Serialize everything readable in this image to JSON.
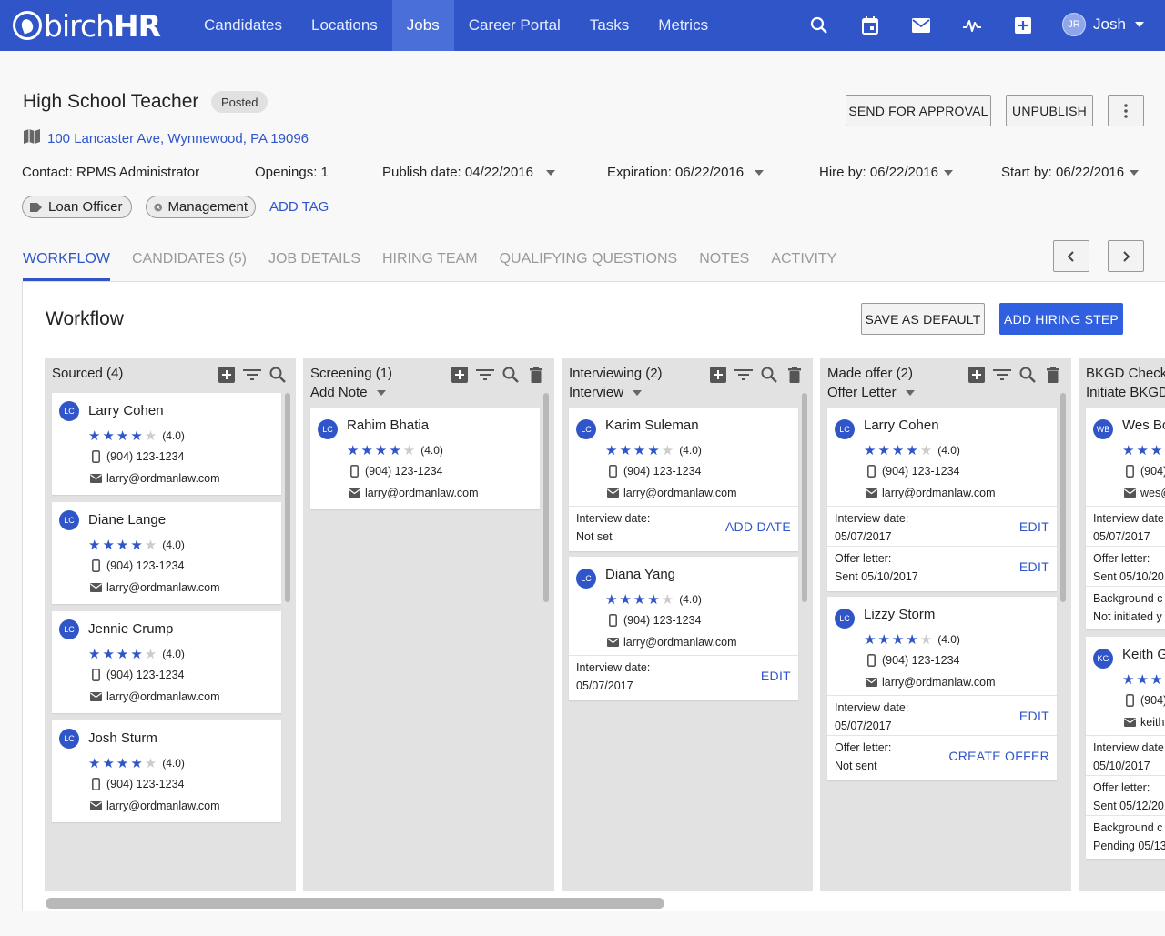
{
  "app": {
    "logo": "birchHR",
    "logo_regular": "birch",
    "logo_bold": "HR"
  },
  "nav": {
    "items": [
      "Candidates",
      "Locations",
      "Jobs",
      "Career Portal",
      "Tasks",
      "Metrics"
    ],
    "active": "Jobs"
  },
  "top_icons": [
    "search-icon",
    "calendar-icon",
    "mail-icon",
    "activity-icon",
    "add-icon"
  ],
  "user": {
    "initials": "JR",
    "name": "Josh"
  },
  "job": {
    "title": "High School Teacher",
    "status": "Posted",
    "address": "100 Lancaster Ave, Wynnewood, PA 19096",
    "contact": "Contact: RPMS Administrator",
    "openings": "Openings: 1",
    "publish": "Publish date: 04/22/2016",
    "expiration": "Expiration: 06/22/2016",
    "hire_by": "Hire by: 06/22/2016",
    "start_by": "Start by: 06/22/2016",
    "tags": [
      "Loan Officer",
      "Management"
    ],
    "add_tag": "ADD TAG"
  },
  "actions": {
    "send_for_approval": "SEND FOR APPROVAL",
    "unpublish": "UNPUBLISH"
  },
  "tabs": [
    "WORKFLOW",
    "CANDIDATES (5)",
    "JOB DETAILS",
    "HIRING TEAM",
    "QUALIFYING QUESTIONS",
    "NOTES",
    "ACTIVITY"
  ],
  "active_tab": "WORKFLOW",
  "workflow": {
    "title": "Workflow",
    "save_default": "SAVE AS DEFAULT",
    "add_step": "ADD HIRING STEP",
    "columns": [
      {
        "title": "Sourced (4)",
        "sub": "",
        "cards": [
          {
            "initials": "LC",
            "name": "Larry Cohen",
            "rating": "(4.0)",
            "phone": "(904) 123-1234",
            "email": "larry@ordmanlaw.com"
          },
          {
            "initials": "LC",
            "name": "Diane Lange",
            "rating": "(4.0)",
            "phone": "(904) 123-1234",
            "email": "larry@ordmanlaw.com"
          },
          {
            "initials": "LC",
            "name": "Jennie Crump",
            "rating": "(4.0)",
            "phone": "(904) 123-1234",
            "email": "larry@ordmanlaw.com"
          },
          {
            "initials": "LC",
            "name": "Josh Sturm",
            "rating": "(4.0)",
            "phone": "(904) 123-1234",
            "email": "larry@ordmanlaw.com"
          }
        ]
      },
      {
        "title": "Screening (1)",
        "sub": "Add Note",
        "cards": [
          {
            "initials": "LC",
            "name": "Rahim Bhatia",
            "rating": "(4.0)",
            "phone": "(904) 123-1234",
            "email": "larry@ordmanlaw.com"
          }
        ]
      },
      {
        "title": "Interviewing (2)",
        "sub": "Interview",
        "cards": [
          {
            "initials": "LC",
            "name": "Karim Suleman",
            "rating": "(4.0)",
            "phone": "(904) 123-1234",
            "email": "larry@ordmanlaw.com",
            "sections": [
              {
                "label": "Interview date:",
                "value": "Not set",
                "action": "ADD DATE"
              }
            ]
          },
          {
            "initials": "LC",
            "name": "Diana Yang",
            "rating": "(4.0)",
            "phone": "(904) 123-1234",
            "email": "larry@ordmanlaw.com",
            "sections": [
              {
                "label": "Interview date:",
                "value": "05/07/2017",
                "action": "EDIT"
              }
            ]
          }
        ]
      },
      {
        "title": "Made offer (2)",
        "sub": "Offer Letter",
        "cards": [
          {
            "initials": "LC",
            "name": "Larry Cohen",
            "rating": "(4.0)",
            "phone": "(904) 123-1234",
            "email": "larry@ordmanlaw.com",
            "sections": [
              {
                "label": "Interview date:",
                "value": "05/07/2017",
                "action": "EDIT"
              },
              {
                "label": "Offer letter:",
                "value": "Sent 05/10/2017",
                "action": "EDIT"
              }
            ]
          },
          {
            "initials": "LC",
            "name": "Lizzy Storm",
            "rating": "(4.0)",
            "phone": "(904) 123-1234",
            "email": "larry@ordmanlaw.com",
            "sections": [
              {
                "label": "Interview date:",
                "value": "05/07/2017",
                "action": "EDIT"
              },
              {
                "label": "Offer letter:",
                "value": "Not sent",
                "action": "CREATE OFFER"
              }
            ]
          }
        ]
      },
      {
        "title": "BKGD Check (",
        "sub": "Initiate BKGD",
        "cards": [
          {
            "initials": "WB",
            "name": "Wes Bo",
            "phone": "(904)",
            "email": "wes@",
            "sections": [
              {
                "label": "Interview date",
                "value": "05/07/2017"
              },
              {
                "label": "Offer letter:",
                "value": "Sent 05/10/201"
              },
              {
                "label": "Background c",
                "value": "Not initiated y"
              }
            ]
          },
          {
            "initials": "KG",
            "name": "Keith G",
            "phone": "(904)",
            "email": "keith",
            "sections": [
              {
                "label": "Interview date",
                "value": "05/10/2017"
              },
              {
                "label": "Offer letter:",
                "value": "Sent 05/12/201"
              },
              {
                "label": "Background c",
                "value": "Pending 05/13"
              }
            ]
          }
        ]
      }
    ]
  }
}
